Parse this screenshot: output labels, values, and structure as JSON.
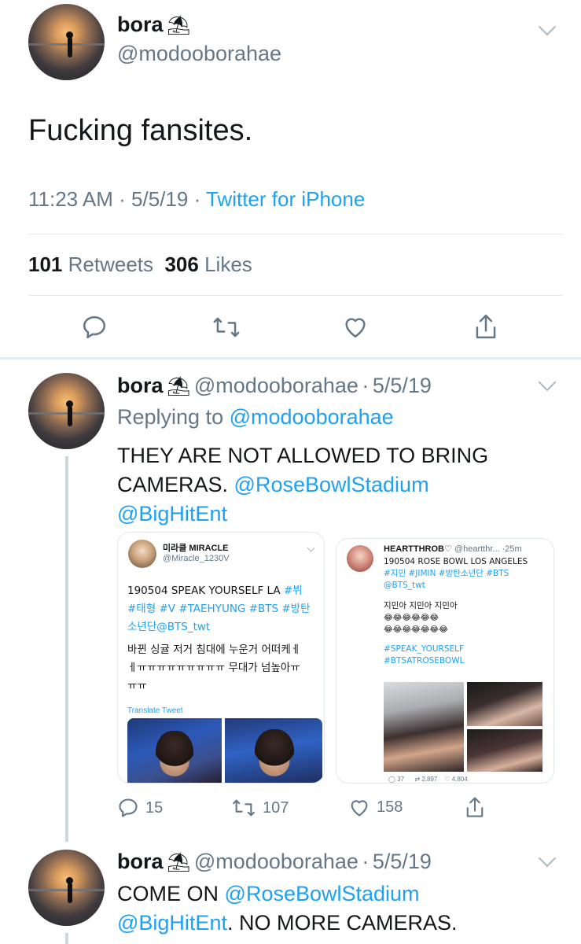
{
  "main_tweet": {
    "display_name": "bora",
    "emoji": "⛱",
    "handle": "@modooborahae",
    "text": "Fucking fansites.",
    "time": "11:23 AM",
    "date": "5/5/19",
    "source": "Twitter for iPhone",
    "retweets_count": "101",
    "retweets_label": "Retweets",
    "likes_count": "306",
    "likes_label": "Likes"
  },
  "reply1": {
    "display_name": "bora",
    "emoji": "⛱",
    "handle": "@modooborahae",
    "date": "5/5/19",
    "replying_prefix": "Replying to",
    "replying_handle": "@modooborahae",
    "text_line1": "THEY ARE NOT ALLOWED TO BRING",
    "text_line2_a": "CAMERAS.",
    "text_line2_mention": "@RoseBowlStadium",
    "text_line3_mention": "@BigHitEnt",
    "reply_count": "15",
    "retweet_count": "107",
    "like_count": "158",
    "embedded_left": {
      "name": "미라클 MIRACLE",
      "handle": "@Miracle_1230V",
      "line1_a": "190504 SPEAK YOURSELF LA ",
      "line1_b": "#뷔",
      "line2": "#태형 #V #TAEHYUNG #BTS #방탄",
      "line3_a": "소년단",
      "line3_b": "@BTS_twt",
      "korean1": "바뀐 싱귤 저거 침대에 누운거 어떠케ㅔ",
      "korean2": "ㅔㅠㅠㅠㅠㅠㅠㅠㅠㅠ 무대가 넘높아ㅠ",
      "korean3": "ㅠㅠ",
      "translate": "Translate Tweet"
    },
    "embedded_right": {
      "name": "HEARTTHROB♡",
      "handle": "@heartthr...",
      "time": "25m",
      "line1": "190504 ROSE BOWL LOS ANGELES",
      "line2": "#지민 #JIMIN #방탄소년단 #BTS",
      "line3": "@BTS_twt",
      "korean": "지민아 지민아 지민아",
      "emojis1": "😂😂😂😂😂😂",
      "emojis2": "😂😂😂😂😂😂😂",
      "tag1": "#SPEAK_YOURSELF",
      "tag2": "#BTSATROSEBOWL",
      "replies": "37",
      "retweets": "2,897",
      "likes": "4,804"
    }
  },
  "reply2": {
    "display_name": "bora",
    "emoji": "⛱",
    "handle": "@modooborahae",
    "date": "5/5/19",
    "line1_a": "COME ON",
    "line1_mention": "@RoseBowlStadium",
    "line2_mention": "@BigHitEnt",
    "line2_b": ". NO MORE CAMERAS."
  },
  "colors": {
    "link": "#1da1f2",
    "muted": "#657786",
    "divider": "#e1e8ed"
  }
}
